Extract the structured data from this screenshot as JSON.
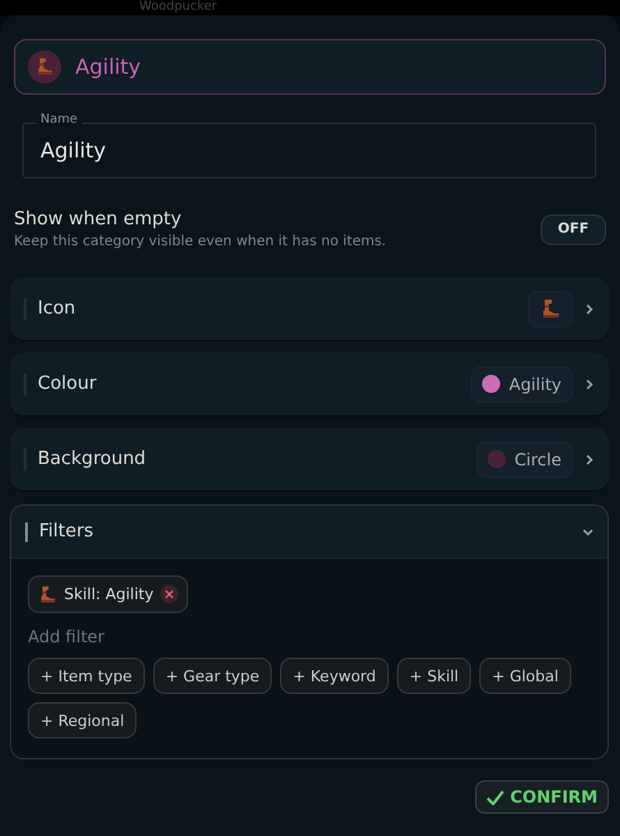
{
  "backdrop": {
    "title": "Woodpucker"
  },
  "header": {
    "title": "Agility"
  },
  "name_field": {
    "label": "Name",
    "value": "Agility"
  },
  "show_when_empty": {
    "label": "Show when empty",
    "description": "Keep this category visible even when it has no items.",
    "on": false,
    "toggle_text": "OFF"
  },
  "settings": [
    {
      "kind": "icon",
      "label": "Icon"
    },
    {
      "kind": "swatch",
      "label": "Colour",
      "value": "Agility",
      "color": "#cc6cb8"
    },
    {
      "kind": "swatch",
      "label": "Background",
      "value": "Circle",
      "color": "#4a2238"
    }
  ],
  "filters": {
    "title": "Filters",
    "expanded": true,
    "active": [
      {
        "label": "Skill: Agility"
      }
    ],
    "add_label": "Add filter",
    "options": [
      "+ Item type",
      "+ Gear type",
      "+ Keyword",
      "+ Skill",
      "+ Global",
      "+ Regional"
    ]
  },
  "confirm": {
    "label": "CONFIRM"
  }
}
